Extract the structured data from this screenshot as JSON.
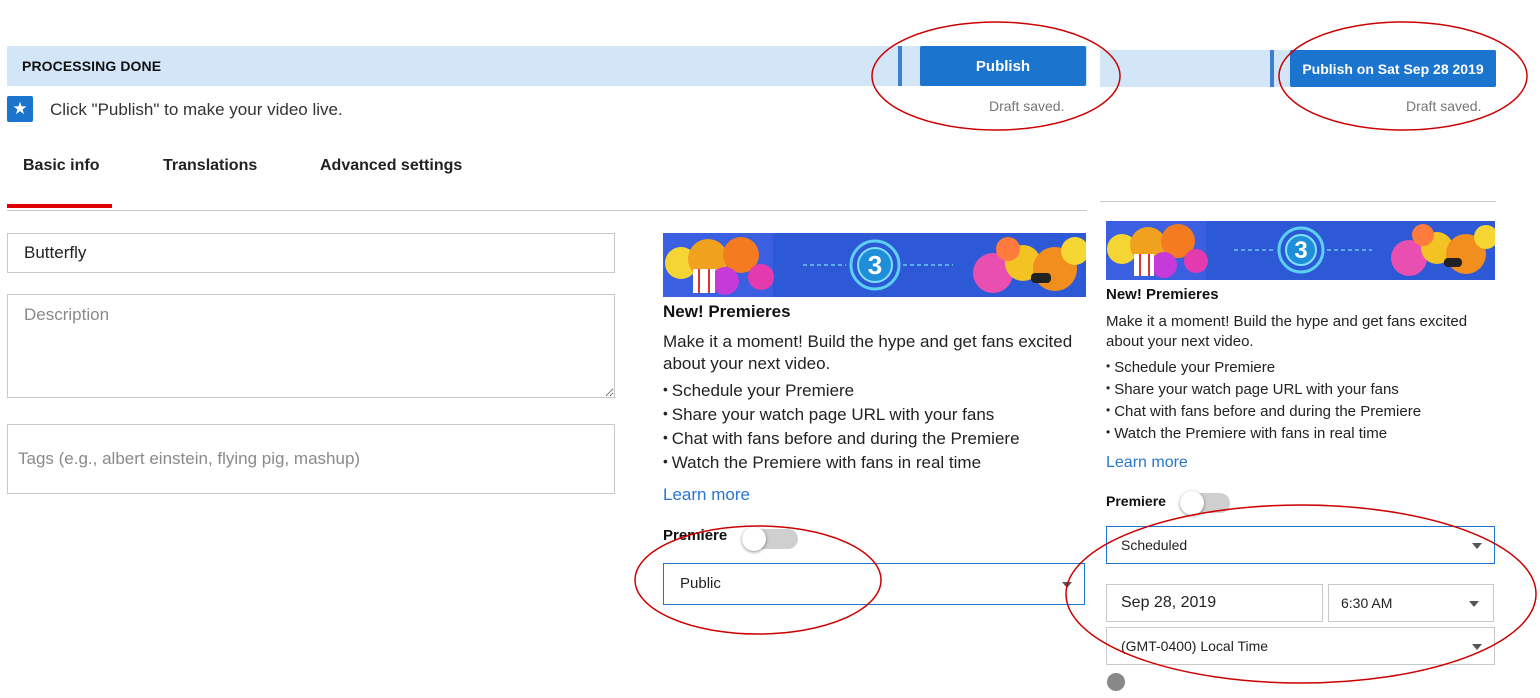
{
  "status": {
    "text": "PROCESSING DONE",
    "publish_label": "Publish",
    "draft_text": "Draft saved."
  },
  "status_right": {
    "publish_label": "Publish on Sat Sep 28 2019",
    "draft_text": "Draft saved."
  },
  "hint": {
    "icon": "star-icon",
    "text": "Click \"Publish\" to make your video live."
  },
  "tabs": [
    {
      "label": "Basic info",
      "active": true
    },
    {
      "label": "Translations",
      "active": false
    },
    {
      "label": "Advanced settings",
      "active": false
    }
  ],
  "form": {
    "title_value": "Butterfly",
    "description_placeholder": "Description",
    "tags_placeholder": "Tags (e.g., albert einstein, flying pig, mashup)"
  },
  "premiere_card": {
    "title": "New! Premieres",
    "body": "Make it a moment! Build the hype and get fans excited about your next video.",
    "bullets": [
      "Schedule your Premiere",
      "Share your watch page URL with your fans",
      "Chat with fans before and during the Premiere",
      "Watch the Premiere with fans in real time"
    ],
    "learn_more": "Learn more",
    "premiere_label": "Premiere",
    "banner_number": "3",
    "premiere_enabled": false
  },
  "visibility_left": {
    "selected": "Public"
  },
  "visibility_right": {
    "selected": "Scheduled"
  },
  "schedule": {
    "date": "Sep 28, 2019",
    "time": "6:30 AM",
    "timezone": "(GMT-0400) Local Time"
  },
  "colors": {
    "accent_blue": "#1b75cf",
    "status_bar_bg": "#d2e6f8",
    "tab_underline_red": "#e00000",
    "annotation_red": "#cc0000",
    "link_blue": "#2b75cf"
  }
}
